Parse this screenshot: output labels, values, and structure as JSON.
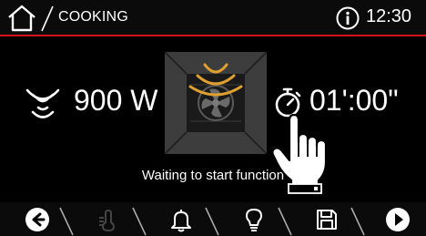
{
  "header": {
    "title": "COOKING",
    "time": "12:30",
    "icons": {
      "home": "home-icon",
      "info": "info-icon"
    },
    "accent_color": "#d4141c"
  },
  "main": {
    "power": {
      "value": "900 W",
      "icon": "microwave-waves-icon"
    },
    "oven": {
      "icon": "oven-fan-icon",
      "accent_color": "#e0a030"
    },
    "timer": {
      "value": "01':00\"",
      "icon": "stopwatch-icon"
    },
    "status": "Waiting to start function",
    "pointer": "hand-pointer-icon"
  },
  "bottom_bar": {
    "buttons": [
      {
        "icon": "back-arrow-icon",
        "enabled": true
      },
      {
        "icon": "thermometer-icon",
        "enabled": false
      },
      {
        "icon": "bell-icon",
        "enabled": true
      },
      {
        "icon": "lightbulb-icon",
        "enabled": true
      },
      {
        "icon": "save-icon",
        "enabled": true
      },
      {
        "icon": "play-forward-icon",
        "enabled": true
      }
    ]
  }
}
